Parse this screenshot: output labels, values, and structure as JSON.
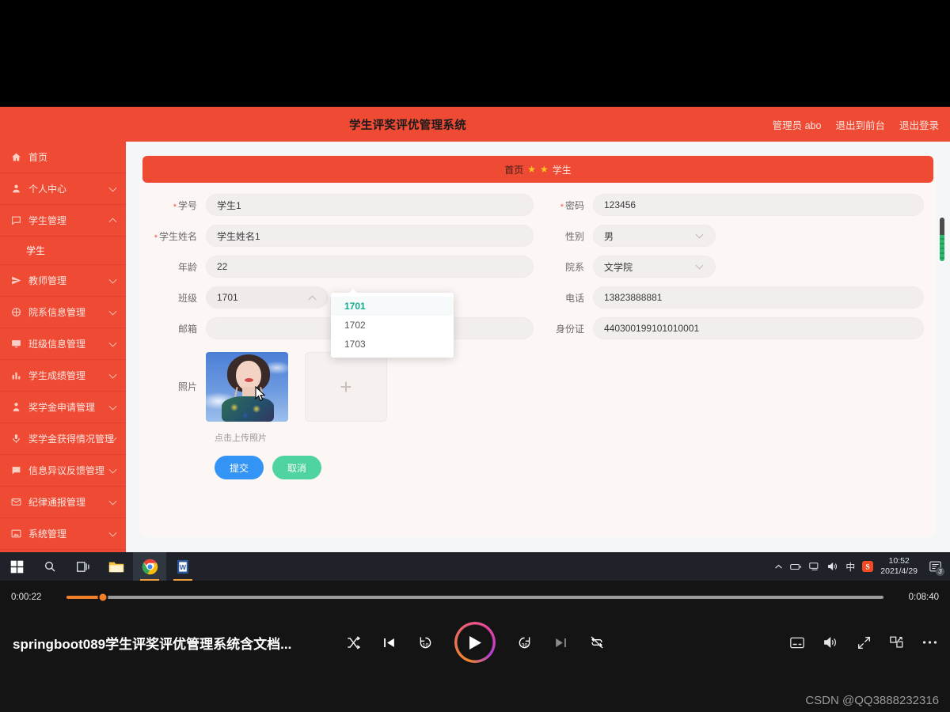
{
  "app": {
    "title": "学生评奖评优管理系统",
    "header_links": [
      "管理员 abo",
      "退出到前台",
      "退出登录"
    ]
  },
  "sidebar": {
    "items": [
      {
        "label": "首页",
        "icon": "home-icon",
        "caret": "none"
      },
      {
        "label": "个人中心",
        "icon": "user-icon",
        "caret": "down"
      },
      {
        "label": "学生管理",
        "icon": "message-icon",
        "caret": "up"
      },
      {
        "label": "教师管理",
        "icon": "send-icon",
        "caret": "down"
      },
      {
        "label": "院系信息管理",
        "icon": "compass-icon",
        "caret": "down"
      },
      {
        "label": "班级信息管理",
        "icon": "monitor-icon",
        "caret": "down"
      },
      {
        "label": "学生成绩管理",
        "icon": "bar-chart-icon",
        "caret": "down"
      },
      {
        "label": "奖学金申请管理",
        "icon": "person-icon",
        "caret": "down"
      },
      {
        "label": "奖学金获得情况管理",
        "icon": "microphone-icon",
        "caret": "down"
      },
      {
        "label": "信息异议反馈管理",
        "icon": "chat-icon",
        "caret": "down"
      },
      {
        "label": "纪律通报管理",
        "icon": "mail-icon",
        "caret": "down"
      },
      {
        "label": "系统管理",
        "icon": "picture-icon",
        "caret": "down"
      }
    ],
    "submenu_label": "学生"
  },
  "breadcrumb": {
    "home": "首页",
    "star": "★",
    "current": "学生"
  },
  "form": {
    "rows": [
      {
        "left": {
          "label": "学号",
          "required": true,
          "value": "学生1",
          "type": "text"
        },
        "right": {
          "label": "密码",
          "required": true,
          "value": "123456",
          "type": "text"
        }
      },
      {
        "left": {
          "label": "学生姓名",
          "required": true,
          "value": "学生姓名1",
          "type": "text"
        },
        "right": {
          "label": "性别",
          "required": false,
          "value": "男",
          "type": "select"
        }
      },
      {
        "left": {
          "label": "年龄",
          "required": false,
          "value": "22",
          "type": "text"
        },
        "right": {
          "label": "院系",
          "required": false,
          "value": "文学院",
          "type": "select"
        }
      },
      {
        "left": {
          "label": "班级",
          "required": false,
          "value": "1701",
          "type": "select-open"
        },
        "right": {
          "label": "电话",
          "required": false,
          "value": "13823888881",
          "type": "text"
        }
      },
      {
        "left": {
          "label": "邮箱",
          "required": false,
          "value": "",
          "type": "text"
        },
        "right": {
          "label": "身份证",
          "required": false,
          "value": "440300199101010001",
          "type": "text"
        }
      }
    ],
    "class_dropdown": {
      "options": [
        "1701",
        "1702",
        "1703"
      ],
      "selected": "1701"
    },
    "photo": {
      "label": "照片",
      "add_glyph": "+",
      "hint": "点击上传照片"
    },
    "buttons": {
      "submit": "提交",
      "cancel": "取消"
    }
  },
  "taskbar": {
    "apps": [
      "windows-start-icon",
      "search-icon",
      "task-view-icon",
      "file-explorer-icon",
      "chrome-icon",
      "word-icon"
    ],
    "tray": [
      "chevron-up-icon",
      "battery-icon",
      "network-icon",
      "volume-icon"
    ],
    "ime": "中",
    "sogou": "S",
    "time": "10:52",
    "date": "2021/4/29",
    "notification_count": "3"
  },
  "player": {
    "current_time": "0:00:22",
    "duration": "0:08:40",
    "progress_percent": 4.5,
    "video_title": "springboot089学生评奖评优管理系统含文档...",
    "controls": [
      "shuffle-icon",
      "previous-icon",
      "rewind-10-icon",
      "play-icon",
      "forward-30-icon",
      "next-icon",
      "repeat-off-icon"
    ],
    "right_controls": [
      "subtitles-icon",
      "volume-icon",
      "expand-icon",
      "picture-in-picture-icon",
      "more-icon"
    ],
    "watermark": "CSDN @QQ3888232316"
  },
  "colors": {
    "brand": "#ef4a33",
    "submit": "#3494f5",
    "cancel": "#4fd3a1",
    "dropdown_selected": "#13ab8e",
    "progress": "#f2802a"
  }
}
